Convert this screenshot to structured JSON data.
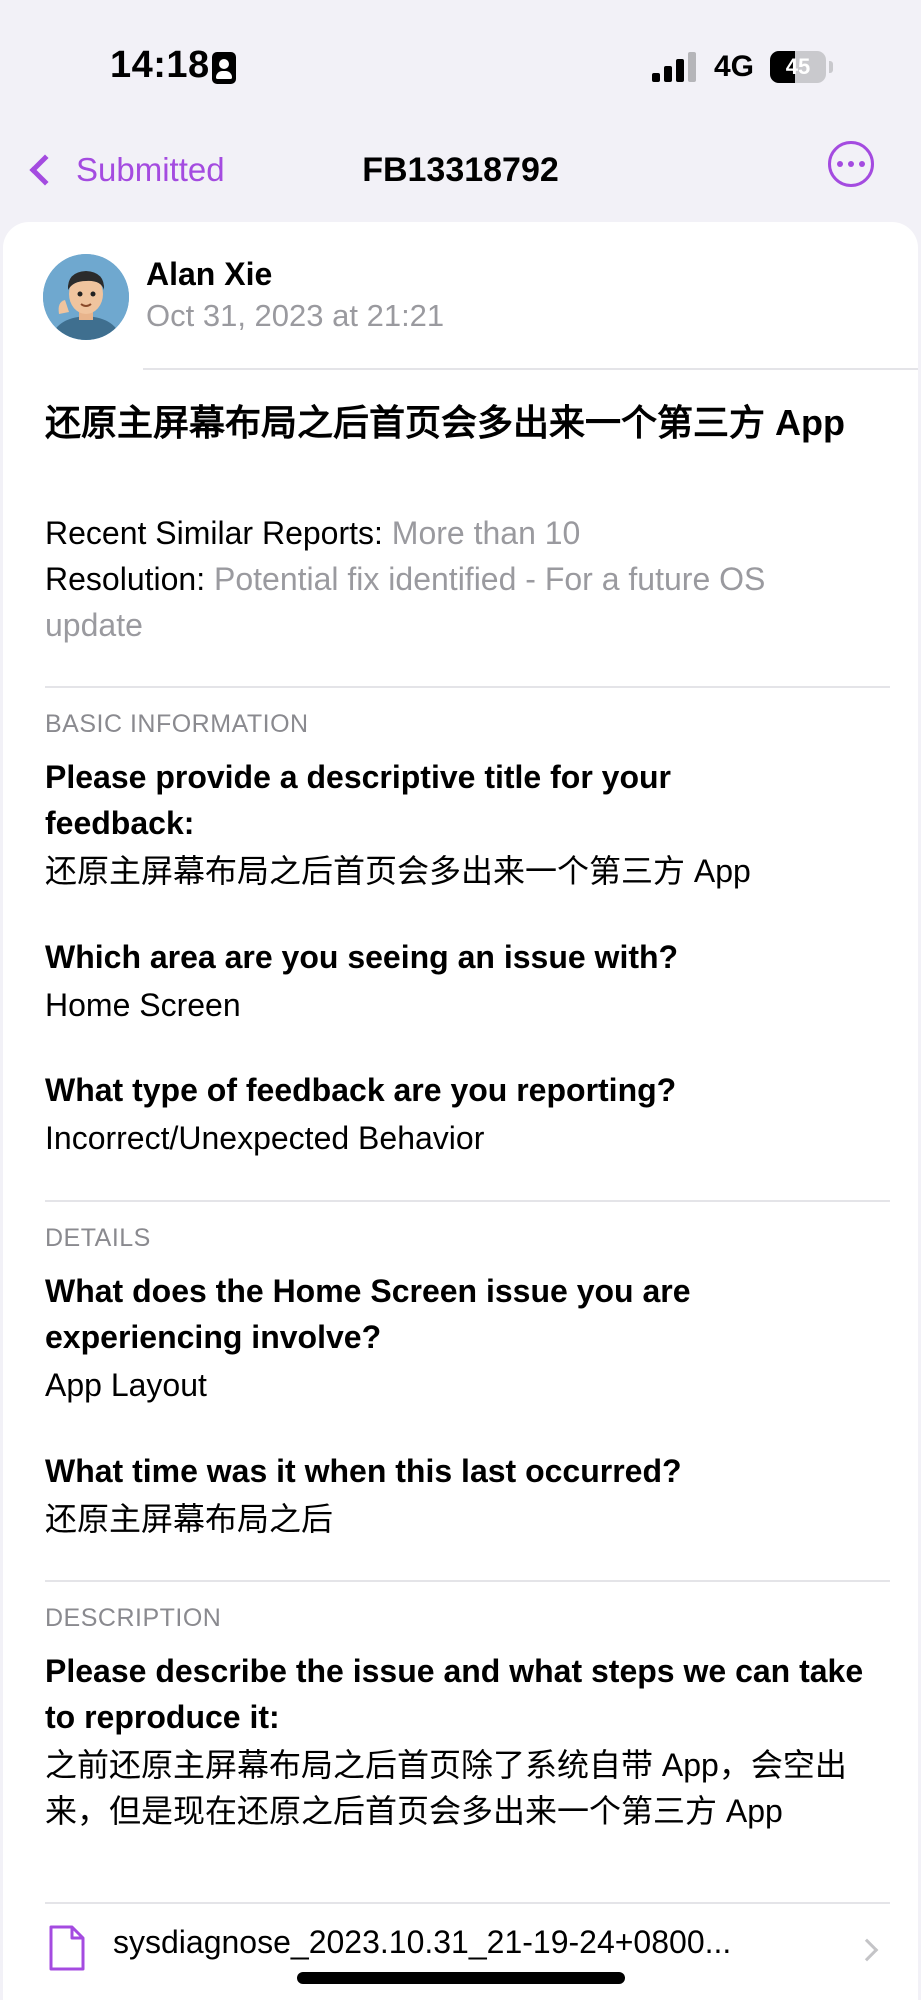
{
  "status_bar": {
    "time": "14:18",
    "network": "4G",
    "battery_percent": "45",
    "battery_level": 0.45,
    "signal_bars_filled": 3,
    "signal_bars_total": 4,
    "id_icon": "person-card-icon"
  },
  "nav": {
    "back_label": "Submitted",
    "title": "FB13318792",
    "more_icon": "ellipsis-circle-icon",
    "accent_color": "#a44be0"
  },
  "author": {
    "name": "Alan Xie",
    "date": "Oct 31, 2023 at 21:21",
    "avatar_icon": "memoji-avatar"
  },
  "report": {
    "title": "还原主屏幕布局之后首页会多出来一个第三方 App",
    "similar_label": "Recent Similar Reports:",
    "similar_value": "More than 10",
    "resolution_label": "Resolution:",
    "resolution_value": "Potential fix identified - For a future OS update"
  },
  "sections": {
    "basic": {
      "header": "BASIC INFORMATION",
      "q1": "Please provide a descriptive title for your feedback:",
      "a1": "还原主屏幕布局之后首页会多出来一个第三方 App",
      "q2": "Which area are you seeing an issue with?",
      "a2": "Home Screen",
      "q3": "What type of feedback are you reporting?",
      "a3": "Incorrect/Unexpected Behavior"
    },
    "details": {
      "header": "DETAILS",
      "q1": "What does the Home Screen issue you are experiencing involve?",
      "a1": "App Layout",
      "q2": "What time was it when this last occurred?",
      "a2": "还原主屏幕布局之后"
    },
    "description": {
      "header": "DESCRIPTION",
      "q1": "Please describe the issue and what steps we can take to reproduce it:",
      "a1": "之前还原主屏幕布局之后首页除了系统自带 App，会空出来，但是现在还原之后首页会多出来一个第三方 App"
    }
  },
  "attachment": {
    "name": "sysdiagnose_2023.10.31_21-19-24+0800...",
    "icon": "document-icon"
  }
}
